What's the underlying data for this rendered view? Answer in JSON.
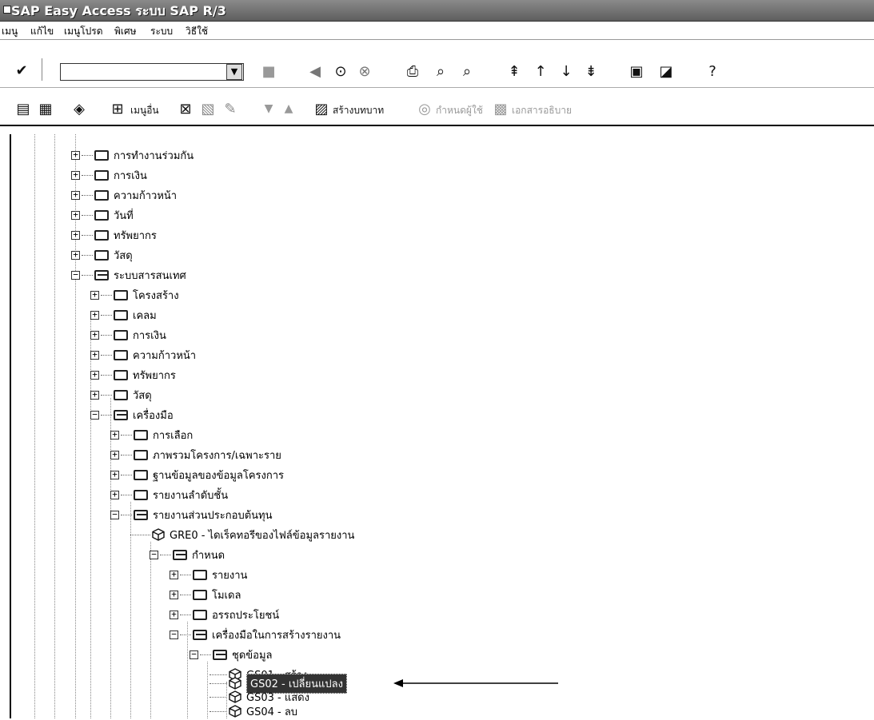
{
  "window": {
    "title": "SAP Easy Access  ระบบ SAP R/3"
  },
  "menu": [
    "เมนู",
    "แก้ไข",
    "เมนูโปรด",
    "พิเศษ",
    "ระบบ",
    "วิธีใช้"
  ],
  "toolbar": {
    "command_field_value": "",
    "other_menu_label": "เมนูอื่น",
    "create_role_label": "สร้างบทบาท",
    "assign_users_label": "กำหนดผู้ใช้",
    "documentation_label": "เอกสารอธิบาย"
  },
  "tree": [
    {
      "label": "การทำงานร่วมกัน",
      "type": "folder",
      "expanded": false
    },
    {
      "label": "การเงิน",
      "type": "folder",
      "expanded": false
    },
    {
      "label": "ความก้าวหน้า",
      "type": "folder",
      "expanded": false
    },
    {
      "label": "วันที่",
      "type": "folder",
      "expanded": false
    },
    {
      "label": "ทรัพยากร",
      "type": "folder",
      "expanded": false
    },
    {
      "label": "วัสดุ",
      "type": "folder",
      "expanded": false
    },
    {
      "label": "ระบบสารสนเทศ",
      "type": "folder",
      "expanded": true
    },
    {
      "label": "โครงสร้าง",
      "type": "folder",
      "expanded": false
    },
    {
      "label": "เคลม",
      "type": "folder",
      "expanded": false
    },
    {
      "label": "การเงิน",
      "type": "folder",
      "expanded": false
    },
    {
      "label": "ความก้าวหน้า",
      "type": "folder",
      "expanded": false
    },
    {
      "label": "ทรัพยากร",
      "type": "folder",
      "expanded": false
    },
    {
      "label": "วัสดุ",
      "type": "folder",
      "expanded": false
    },
    {
      "label": "เครื่องมือ",
      "type": "folder",
      "expanded": true
    },
    {
      "label": "การเลือก",
      "type": "folder",
      "expanded": false
    },
    {
      "label": "ภาพรวมโครงการ/เฉพาะราย",
      "type": "folder",
      "expanded": false
    },
    {
      "label": "ฐานข้อมูลของข้อมูลโครงการ",
      "type": "folder",
      "expanded": false
    },
    {
      "label": "รายงานลำดับชั้น",
      "type": "folder",
      "expanded": false
    },
    {
      "label": "รายงานส่วนประกอบต้นทุน",
      "type": "folder",
      "expanded": true
    },
    {
      "label": "GRE0 - ไดเร็คทอรีของไฟล์ข้อมูลรายงาน",
      "type": "transaction"
    },
    {
      "label": "กำหนด",
      "type": "folder",
      "expanded": true
    },
    {
      "label": "รายงาน",
      "type": "folder",
      "expanded": false
    },
    {
      "label": "โมเดล",
      "type": "folder",
      "expanded": false
    },
    {
      "label": "อรรถประโยชน์",
      "type": "folder",
      "expanded": false
    },
    {
      "label": "เครื่องมือในการสร้างรายงาน",
      "type": "folder",
      "expanded": true
    },
    {
      "label": "ชุดข้อมูล",
      "type": "folder",
      "expanded": true
    },
    {
      "label": "GS01 - สร้าง",
      "type": "transaction"
    },
    {
      "label": "GS02 - เปลี่ยนแปลง",
      "type": "transaction",
      "selected": true
    },
    {
      "label": "GS03 - แสดง",
      "type": "transaction"
    },
    {
      "label": "GS04 - ลบ",
      "type": "transaction"
    }
  ]
}
